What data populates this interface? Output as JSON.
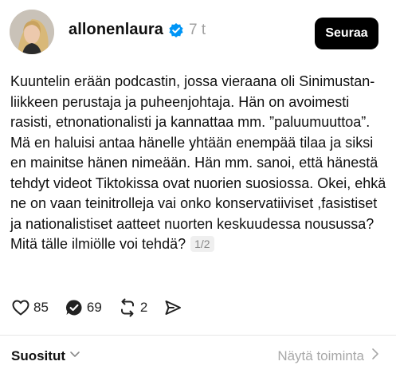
{
  "post": {
    "username": "allonenlaura",
    "verified": true,
    "time": "7 t",
    "follow_label": "Seuraa",
    "text": "Kuuntelin erään podcastin, jossa vieraana oli Sinimustan-liikkeen perustaja ja puheenjohtaja. Hän on avoimesti rasisti, etnonationalisti ja kannattaa mm. ”paluumuuttoa”. Mä en haluisi antaa hänelle yhtään enempää tilaa ja siksi en mainitse hänen nimeään. Hän mm. sanoi, että hänestä tehdyt videot Tiktokissa ovat nuorien suosiossa. Okei, ehkä ne on vaan teinitrolleja vai onko konservatiiviset ,fasistiset ja nationalistiset aatteet nuorten keskuudessa nousussa? Mitä tälle ilmiölle voi tehdä?",
    "page_indicator": "1/2"
  },
  "actions": {
    "likes": "85",
    "comments": "69",
    "reposts": "2"
  },
  "footer": {
    "sort_label": "Suositut",
    "view_activity": "Näytä toiminta"
  },
  "icons": {
    "like": "heart-icon",
    "comment": "comment-icon",
    "repost": "repost-icon",
    "share": "share-icon",
    "verified": "verified-badge-icon",
    "sort": "chevron-down-icon",
    "view_activity": "chevron-right-icon"
  },
  "colors": {
    "follow_button_bg": "#000000",
    "verified_badge": "#0095f6",
    "muted_text": "#a0a0a0"
  }
}
